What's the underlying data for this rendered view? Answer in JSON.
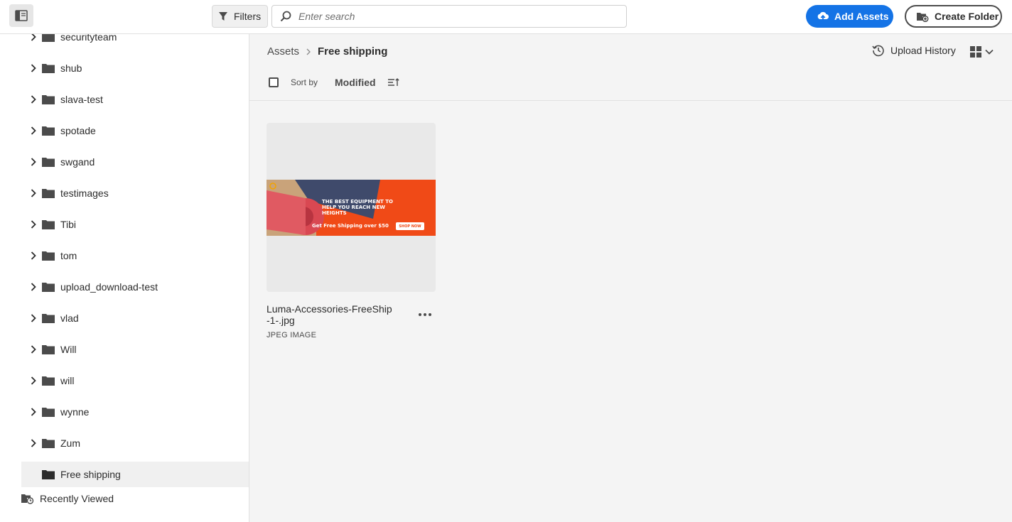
{
  "topbar": {
    "filters_label": "Filters",
    "search_placeholder": "Enter search",
    "add_assets_label": "Add Assets",
    "create_folder_label": "Create Folder"
  },
  "sidebar": {
    "items": [
      {
        "label": "securityteam"
      },
      {
        "label": "shub"
      },
      {
        "label": "slava-test"
      },
      {
        "label": "spotade"
      },
      {
        "label": "swgand"
      },
      {
        "label": "testimages"
      },
      {
        "label": "Tibi"
      },
      {
        "label": "tom"
      },
      {
        "label": "upload_download-test"
      },
      {
        "label": "vlad"
      },
      {
        "label": "Will"
      },
      {
        "label": "will"
      },
      {
        "label": "wynne"
      },
      {
        "label": "Zum"
      },
      {
        "label": "Free shipping",
        "selected": true
      }
    ],
    "recently_viewed_label": "Recently Viewed"
  },
  "main": {
    "breadcrumb": {
      "root": "Assets",
      "current": "Free shipping"
    },
    "upload_history_label": "Upload History",
    "sort": {
      "label": "Sort by",
      "field": "Modified"
    },
    "assets": [
      {
        "name": "Luma-Accessories-FreeShip -1-.jpg",
        "type": "JPEG IMAGE",
        "banner_headline": "THE BEST EQUIPMENT TO HELP YOU REACH NEW HEIGHTS",
        "banner_promo": "Get Free Shipping over $50",
        "banner_cta": "SHOP NOW"
      }
    ]
  },
  "colors": {
    "accent": "#1473e6",
    "banner": "#f04a17"
  }
}
